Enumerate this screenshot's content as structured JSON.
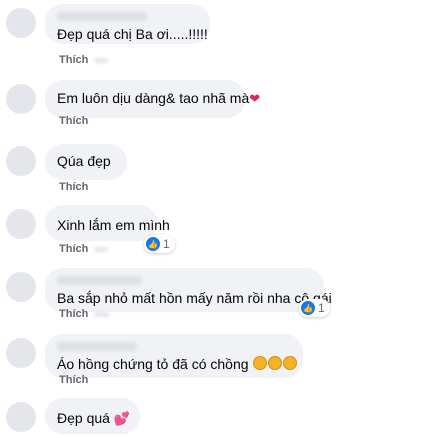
{
  "comments": [
    {
      "text": "Đẹp quá chị Ba ơi.....!!!!!",
      "action": "Thích"
    },
    {
      "text": "Em luôn dịu dàng& tao nhã mà",
      "action": "Thích",
      "emoji": "heart"
    },
    {
      "text": "Qúa đẹp",
      "action": "Thích"
    },
    {
      "text": "Xinh lắm em mình",
      "action": "Thích",
      "reaction_count": "1"
    },
    {
      "text": "Ba sắp nhỏ mất hồn mấy năm rồi nha cô gái",
      "action": "Thích",
      "reaction_count": "1"
    },
    {
      "text": "Áo hồng chứng tỏ đã có chồng",
      "action": "Thích",
      "emoji": "laughing-faces"
    },
    {
      "text": "Đẹp quá",
      "emoji": "two-hearts"
    }
  ],
  "colors": {
    "bubble": "#f0f2f5",
    "text": "#050505",
    "secondary": "#65676b",
    "like_blue": "#1877f2",
    "heart": "#e0245e"
  }
}
